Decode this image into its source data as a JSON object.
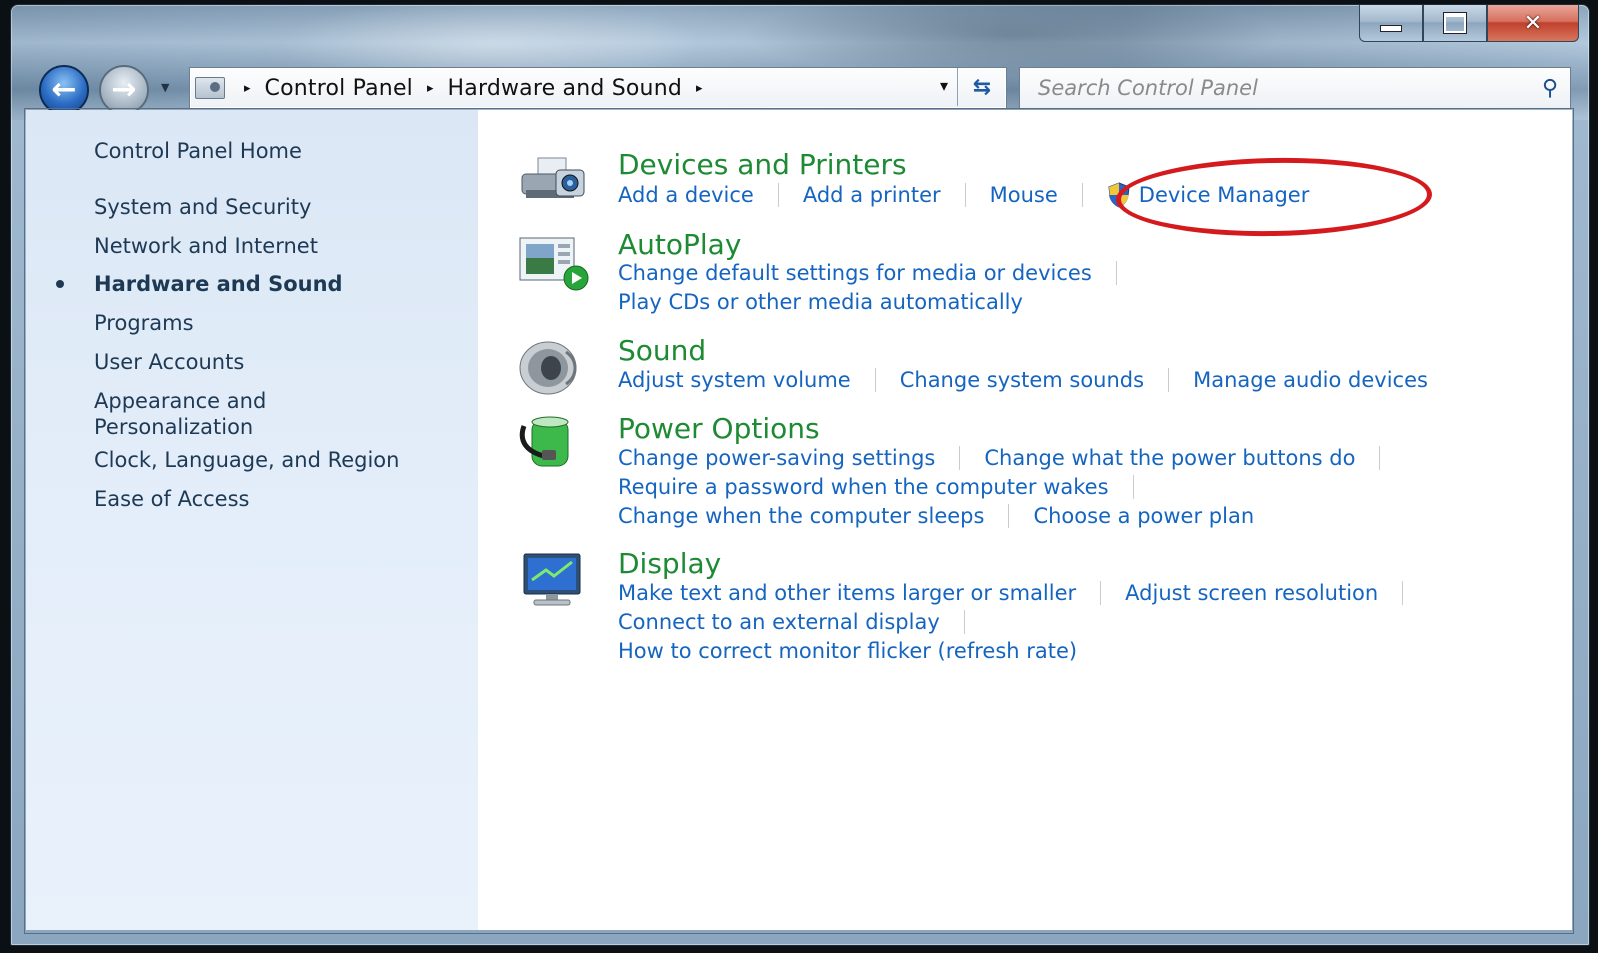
{
  "window": {
    "caption": {
      "minimize_glyph": "minimize",
      "maximize_glyph": "maximize",
      "close_glyph": "✕"
    }
  },
  "address_bar": {
    "crumbs": [
      "Control Panel",
      "Hardware and Sound"
    ],
    "separator": "▸",
    "dropdown": "▾",
    "refresh": "⇆"
  },
  "search": {
    "placeholder": "Search Control Panel",
    "value": ""
  },
  "sidebar": {
    "items": [
      {
        "label": "Control Panel Home",
        "active": false
      },
      {
        "label": "System and Security",
        "active": false
      },
      {
        "label": "Network and Internet",
        "active": false
      },
      {
        "label": "Hardware and Sound",
        "active": true
      },
      {
        "label": "Programs",
        "active": false
      },
      {
        "label": "User Accounts",
        "active": false
      },
      {
        "label": "Appearance and Personalization",
        "line1": "Appearance and",
        "line2": "Personalization",
        "active": false
      },
      {
        "label": "Clock, Language, and Region",
        "active": false
      },
      {
        "label": "Ease of Access",
        "active": false
      }
    ]
  },
  "categories": {
    "devices": {
      "title": "Devices and Printers",
      "links": [
        "Add a device",
        "Add a printer",
        "Mouse",
        "Device Manager"
      ],
      "icon": "printer-camera-icon"
    },
    "autoplay": {
      "title": "AutoPlay",
      "links": [
        "Change default settings for media or devices",
        "Play CDs or other media automatically"
      ],
      "icon": "autoplay-icon"
    },
    "sound": {
      "title": "Sound",
      "links": [
        "Adjust system volume",
        "Change system sounds",
        "Manage audio devices"
      ],
      "icon": "speaker-icon"
    },
    "power": {
      "title": "Power Options",
      "links": [
        "Change power-saving settings",
        "Change what the power buttons do",
        "Require a password when the computer wakes",
        "Change when the computer sleeps",
        "Choose a power plan"
      ],
      "icon": "battery-icon"
    },
    "display": {
      "title": "Display",
      "links": [
        "Make text and other items larger or smaller",
        "Adjust screen resolution",
        "Connect to an external display",
        "How to correct monitor flicker (refresh rate)"
      ],
      "icon": "monitor-icon"
    }
  },
  "colors": {
    "link": "#1565c0",
    "category_title": "#1e8b34",
    "highlight_ellipse": "#d51a1e"
  }
}
